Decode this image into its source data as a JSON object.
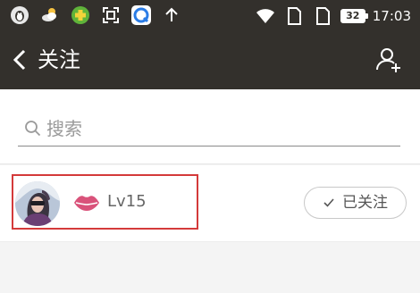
{
  "status_bar": {
    "time": "17:03",
    "battery": "32",
    "left_icons": [
      "qq-penguin-icon",
      "weather-icon",
      "game-icon",
      "scan-icon",
      "app-q-icon",
      "upload-arrow-icon"
    ],
    "right_icons": [
      "wifi-icon",
      "sim-1-icon",
      "sim-2-icon",
      "battery-icon"
    ]
  },
  "nav": {
    "title": "关注",
    "back_icon": "chevron-left-icon",
    "action_icon": "add-user-icon"
  },
  "search": {
    "placeholder": "搜索"
  },
  "following_list": [
    {
      "level": "Lv15",
      "follow_status": "已关注",
      "badge_icon": "lips-icon"
    }
  ],
  "colors": {
    "header_bg": "#33302c",
    "highlight_border": "#d43a3a",
    "lips": "#d9527a"
  }
}
